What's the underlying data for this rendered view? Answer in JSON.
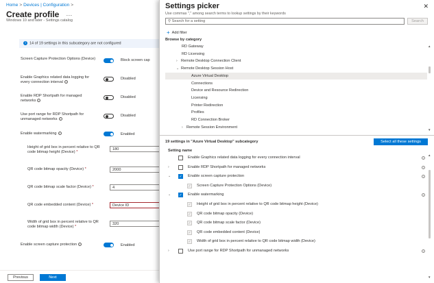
{
  "breadcrumb": [
    "Home",
    "Devices | Configuration"
  ],
  "page": {
    "title": "Create profile",
    "subtitle": "Windows 10 and later - Settings catalog",
    "info_text": "14 of 19 settings in this subcategory are not configured"
  },
  "settings": [
    {
      "label": "Screen Capture Protection Options (Device)",
      "control": "toggle",
      "on": true,
      "value": "Block screen cap"
    },
    {
      "label": "Enable Graphics related data logging for every connection interval",
      "control": "toggle",
      "on": false,
      "value": "Disabled"
    },
    {
      "label": "Enable RDP Shortpath for managed networks",
      "control": "toggle",
      "on": false,
      "value": "Disabled"
    },
    {
      "label": "Use port range for RDP Shortpath for unmanaged networks",
      "control": "toggle",
      "on": false,
      "value": "Disabled"
    },
    {
      "label": "Enable watermarking",
      "control": "toggle",
      "on": true,
      "value": "Enabled"
    },
    {
      "label": "Height of grid box in percent relative to QR code bitmap height (Device)",
      "control": "input",
      "value": "180"
    },
    {
      "label": "QR code bitmap opacity (Device)",
      "control": "input",
      "value": "2000"
    },
    {
      "label": "QR code bitmap scale factor (Device)",
      "control": "input",
      "value": "4"
    },
    {
      "label": "QR code embedded content (Device)",
      "control": "input",
      "value": "Device ID"
    },
    {
      "label": "Width of grid box in percent relative to QR code bitmap width (Device)",
      "control": "input",
      "value": "320"
    },
    {
      "label": "Enable screen capture protection",
      "control": "toggle",
      "on": true,
      "value": "Enabled"
    }
  ],
  "buttons": {
    "previous": "Previous",
    "next": "Next"
  },
  "picker": {
    "title": "Settings picker",
    "subtitle": "Use commas \",\" among search terms to lookup settings by their keywords",
    "search_placeholder": "Search for a setting",
    "search_button": "Search",
    "add_filter": "Add filter",
    "browse_label": "Browse by category",
    "categories": [
      {
        "label": "RD Gateway",
        "chevron": "",
        "selected": false
      },
      {
        "label": "RD Licensing",
        "chevron": "",
        "selected": false
      },
      {
        "label": "Remote Desktop Connection Client",
        "chevron": "›",
        "selected": false
      },
      {
        "label": "Remote Desktop Session Host",
        "chevron": "⌄",
        "selected": false
      },
      {
        "label": "Azure Virtual Desktop",
        "chevron": "",
        "selected": true
      },
      {
        "label": "Connections",
        "chevron": "",
        "selected": false
      },
      {
        "label": "Device and Resource Redirection",
        "chevron": "",
        "selected": false
      },
      {
        "label": "Licensing",
        "chevron": "",
        "selected": false
      },
      {
        "label": "Printer Redirection",
        "chevron": "",
        "selected": false
      },
      {
        "label": "Profiles",
        "chevron": "",
        "selected": false
      },
      {
        "label": "RD Connection Broker",
        "chevron": "",
        "selected": false
      },
      {
        "label": "Remote Session Environment",
        "chevron": "›",
        "selected": false
      }
    ],
    "settings_header": "19 settings in \"Azure Virtual Desktop\" subcategory",
    "select_all": "Select all these settings",
    "column_header": "Setting name",
    "setting_rows": [
      {
        "label": "Enable Graphics related data logging for every connection interval",
        "chevron": "",
        "checked": false,
        "disabled": false
      },
      {
        "label": "Enable RDP Shortpath for managed networks",
        "chevron": "›",
        "checked": false,
        "disabled": false
      },
      {
        "label": "Enable screen capture protection",
        "chevron": "⌄",
        "checked": true,
        "disabled": false
      },
      {
        "label": "Screen Capture Protection Options (Device)",
        "chevron": "",
        "checked": true,
        "disabled": true
      },
      {
        "label": "Enable watermarking",
        "chevron": "⌄",
        "checked": true,
        "disabled": false
      },
      {
        "label": "Height of grid box in percent relative to QR code bitmap height (Device)",
        "chevron": "",
        "checked": true,
        "disabled": true
      },
      {
        "label": "QR code bitmap opacity (Device)",
        "chevron": "",
        "checked": true,
        "disabled": true
      },
      {
        "label": "QR code bitmap scale factor (Device)",
        "chevron": "",
        "checked": true,
        "disabled": true
      },
      {
        "label": "QR code embedded content (Device)",
        "chevron": "",
        "checked": true,
        "disabled": true
      },
      {
        "label": "Width of grid box in percent relative to QR code bitmap width (Device)",
        "chevron": "",
        "checked": true,
        "disabled": true
      },
      {
        "label": "Use port range for RDP Shortpath for unmanaged networks",
        "chevron": "›",
        "checked": false,
        "disabled": false
      }
    ]
  },
  "colors": {
    "accent": "#0078d4",
    "selected_bg": "#edebe9",
    "required": "#a4262c"
  }
}
